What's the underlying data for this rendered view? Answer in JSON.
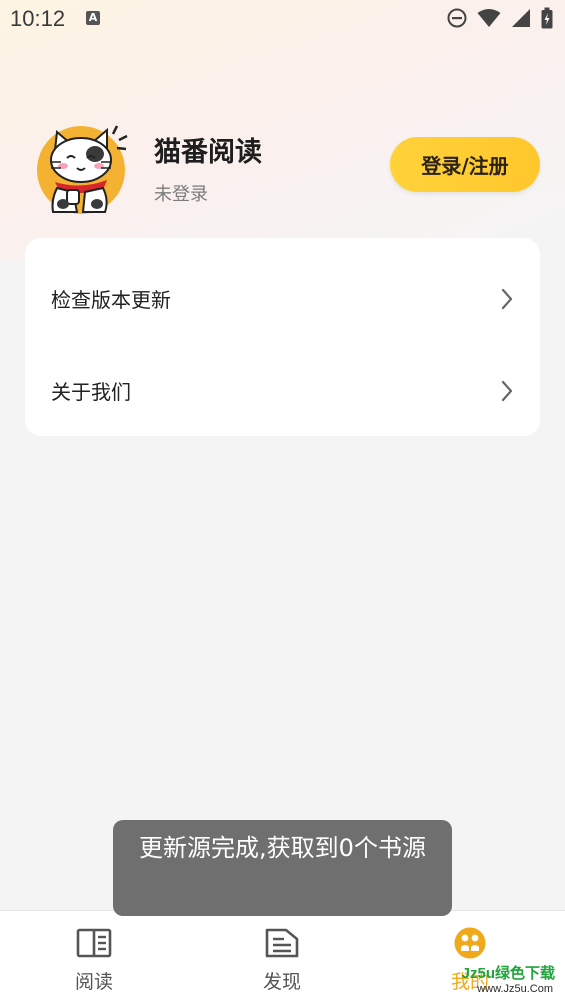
{
  "status_bar": {
    "time": "10:12",
    "notification_letter": "A"
  },
  "profile": {
    "app_name": "猫番阅读",
    "login_status": "未登录",
    "login_button": "登录/注册"
  },
  "menu": [
    {
      "label": "检查版本更新"
    },
    {
      "label": "关于我们"
    }
  ],
  "toast": {
    "message": "更新源完成,获取到0个书源"
  },
  "bottom_nav": [
    {
      "label": "阅读",
      "icon": "book-icon",
      "active": false
    },
    {
      "label": "发现",
      "icon": "document-icon",
      "active": false
    },
    {
      "label": "我的",
      "icon": "profile-icon",
      "active": true
    }
  ],
  "watermark": {
    "main": "Jz5u绿色下载",
    "sub": "www.Jz5u.Com"
  },
  "colors": {
    "accent": "#f0a91b",
    "login_button": "#ffcd33",
    "watermark": "#21a43b"
  }
}
